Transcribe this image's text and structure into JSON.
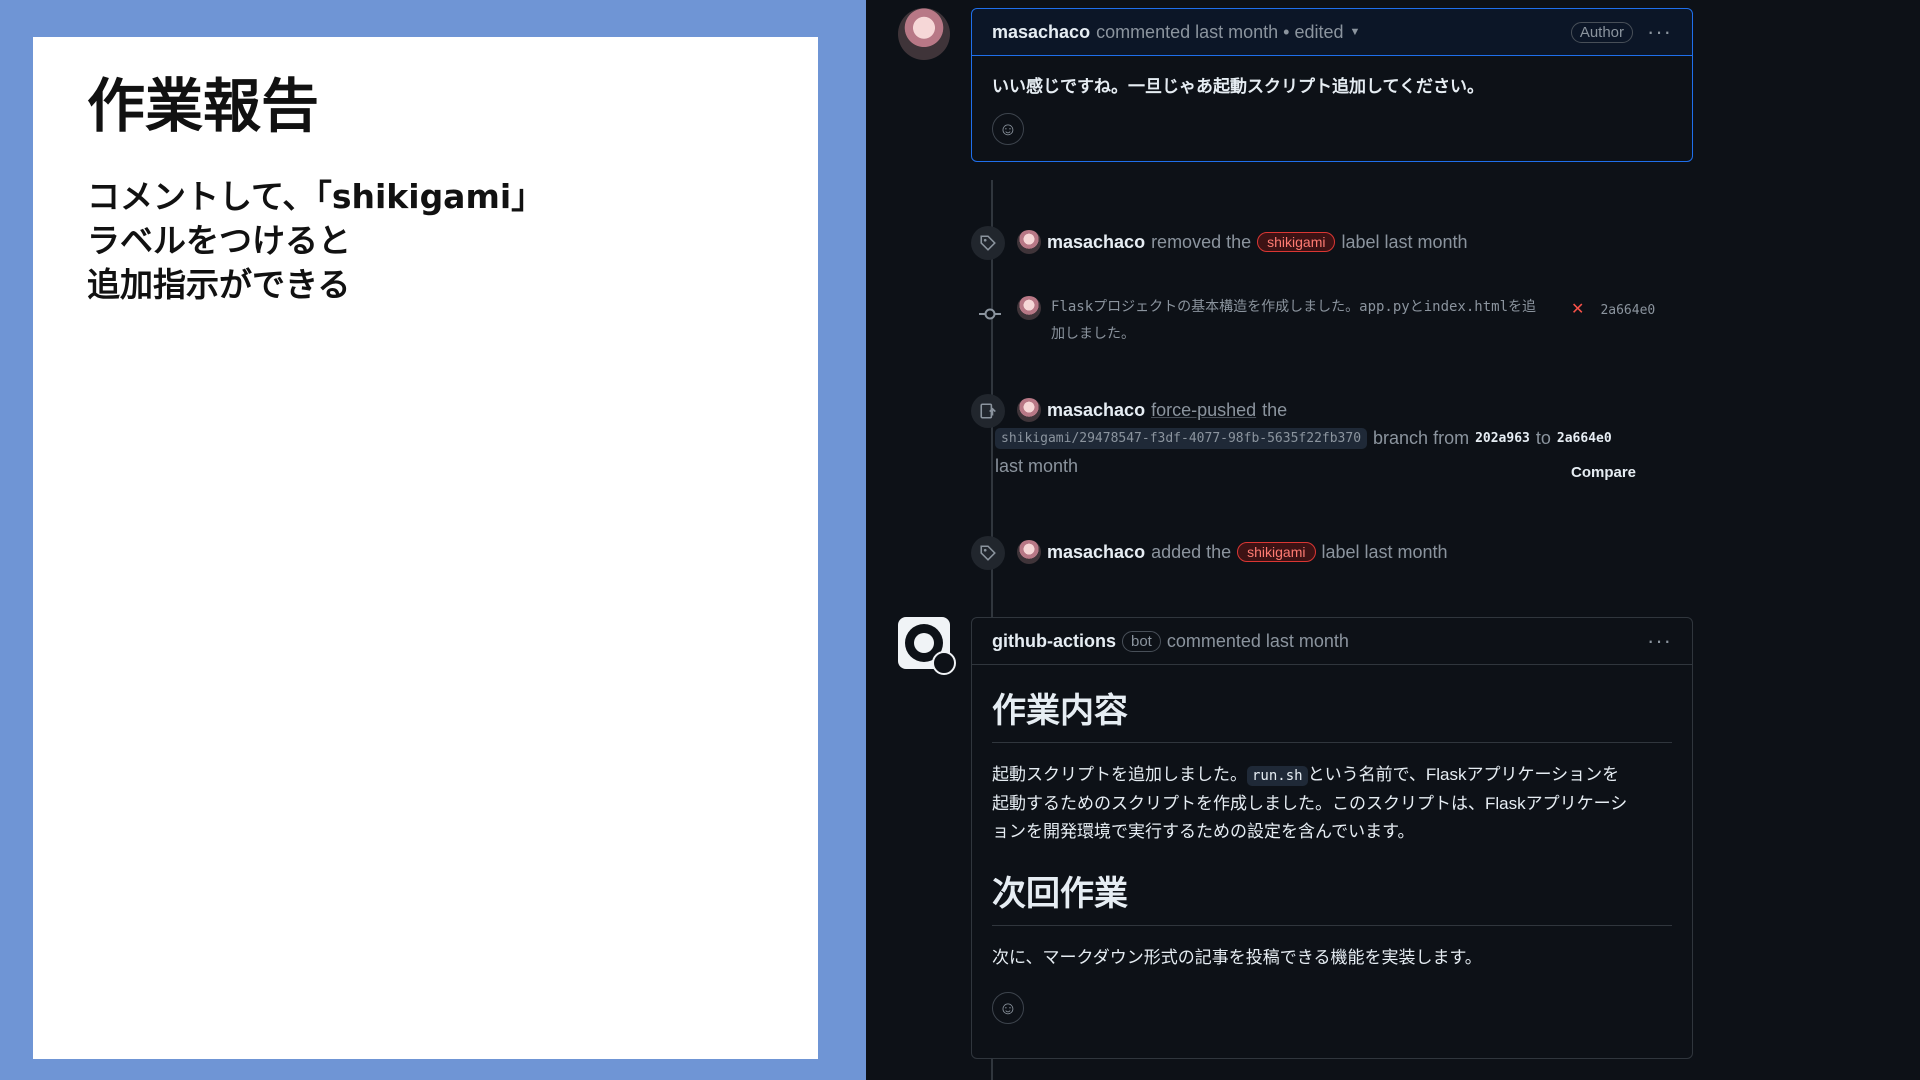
{
  "slide": {
    "title": "作業報告",
    "body_lines": [
      "コメントして、「shikigami」",
      "ラベルをつけると",
      "追加指示ができる"
    ]
  },
  "comment1": {
    "author": "masachaco",
    "meta": "commented last month • edited",
    "author_badge": "Author",
    "body": "いい感じですね。一旦じゃあ起動スクリプト追加してください。"
  },
  "events": {
    "removed": {
      "user": "masachaco",
      "pre": "removed the",
      "label": "shikigami",
      "post": "label last month"
    },
    "commit": {
      "message_line1": "Flaskプロジェクトの基本構造を作成しました。app.pyとindex.htmlを追",
      "message_line2": "加しました。",
      "status_icon": "✕",
      "sha": "2a664e0"
    },
    "force_push": {
      "user": "masachaco",
      "action": "force-pushed",
      "the": "the",
      "branch": "shikigami/29478547-f3df-4077-98fb-5635f22fb370",
      "from_text": "branch from",
      "from_sha": "202a963",
      "to_text": "to",
      "to_sha": "2a664e0",
      "time": "last month",
      "compare": "Compare"
    },
    "added": {
      "user": "masachaco",
      "pre": "added the",
      "label": "shikigami",
      "post": "label last month"
    }
  },
  "comment2": {
    "author": "github-actions",
    "bot_badge": "bot",
    "meta": "commented last month",
    "h1_work": "作業内容",
    "p_work_before": "起動スクリプトを追加しました。",
    "p_work_code": "run.sh",
    "p_work_after1": "という名前で、Flaskアプリケーションを",
    "p_work_line2": "起動するためのスクリプトを作成しました。このスクリプトは、Flaskアプリケーシ",
    "p_work_line3": "ョンを開発環境で実行するための設定を含んでいます。",
    "h1_next": "次回作業",
    "p_next": "次に、マークダウン形式の記事を投稿できる機能を実装します。"
  },
  "icons": {
    "tag": "tag-icon",
    "commit": "git-commit-icon",
    "push": "repo-push-icon",
    "smiley": "smiley-icon",
    "kebab": "kebab-horizontal-icon"
  },
  "colors": {
    "slide_background": "#6f95d5",
    "github_background": "#0d1117",
    "label_red": "#ff7b72",
    "accent_blue": "#1f6feb"
  }
}
